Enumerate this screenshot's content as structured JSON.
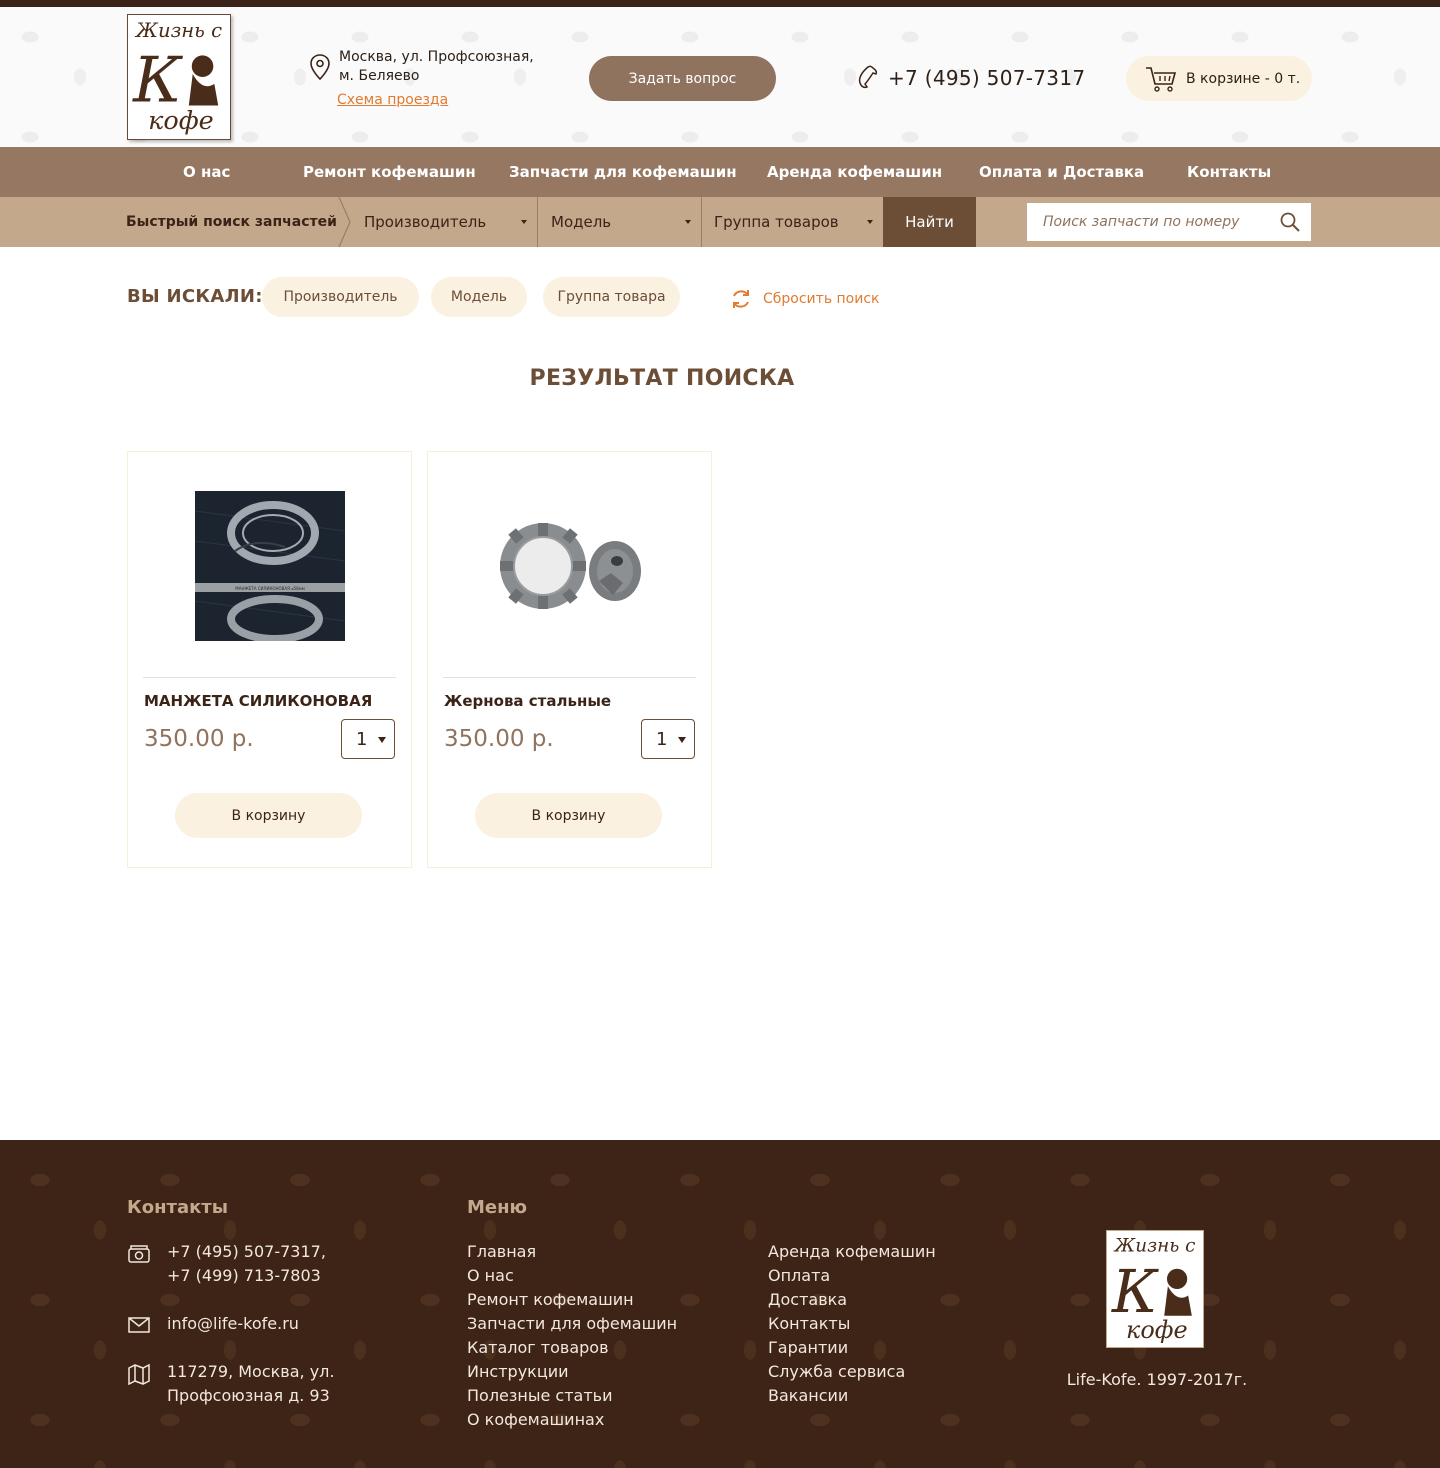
{
  "header": {
    "logo_text_top": "Жизнь с",
    "logo_text_bottom": "кофе",
    "address_line1": "Москва, ул. Профсоюзная,",
    "address_line2": "м. Беляево",
    "route_link": "Схема проезда",
    "ask_button": "Задать вопрос",
    "phone": "+7 (495) 507-7317",
    "cart_label": "В корзине - 0 т."
  },
  "nav": {
    "items": [
      {
        "label": "О нас"
      },
      {
        "label": "Ремонт кофемашин"
      },
      {
        "label": "Запчасти для кофемашин"
      },
      {
        "label": "Аренда кофемашин"
      },
      {
        "label": "Оплата и Доставка"
      },
      {
        "label": "Контакты"
      }
    ]
  },
  "search_bar": {
    "label": "Быстрый поиск запчастей",
    "manufacturer": "Производитель",
    "model": "Модель",
    "group": "Группа товаров",
    "find_button": "Найти",
    "number_placeholder": "Поиск запчасти по номеру"
  },
  "filters": {
    "title": "ВЫ ИСКАЛИ:",
    "chips": [
      "Производитель",
      "Модель",
      "Группа товара"
    ],
    "reset": "Сбросить поиск"
  },
  "results": {
    "title": "РЕЗУЛЬТАТ ПОИСКА",
    "products": [
      {
        "name": "МАНЖЕТА СИЛИКОНОВАЯ",
        "price": "350.00 р.",
        "qty": "1",
        "button": "В корзину",
        "image_caption": "МАНЖЕТА СИЛИКОНОВАЯ ⌀58мм"
      },
      {
        "name": "Жернова стальные",
        "price": "350.00 р.",
        "qty": "1",
        "button": "В корзину"
      }
    ]
  },
  "footer": {
    "contacts_title": "Контакты",
    "phone1": "+7 (495) 507-7317,",
    "phone2": "+7 (499) 713-7803",
    "email": "info@life-kofe.ru",
    "address1": "117279, Москва, ул.",
    "address2": "Профсоюзная д. 93",
    "menu_title": "Меню",
    "menu_col1": [
      "Главная",
      "О нас",
      "Ремонт кофемашин",
      "Запчасти для офемашин",
      "Каталог товаров",
      "Инструкции",
      "Полезные статьи",
      "О кофемашинах"
    ],
    "menu_col2": [
      "Аренда кофемашин",
      "Оплата",
      "Доставка",
      "Контакты",
      "Гарантии",
      "Служба сервиса",
      "Вакансии"
    ],
    "copyright": "Life-Kofe. 1997-2017г."
  },
  "colors": {
    "brand_brown": "#957762",
    "dark_brown": "#3b2417",
    "tan": "#c4a88b",
    "cream": "#fbf1e1",
    "accent_orange": "#e07b2f"
  },
  "icons": [
    "map-pin-icon",
    "phone-icon",
    "cart-icon",
    "search-icon",
    "refresh-icon",
    "footer-phone-icon",
    "mail-icon",
    "map-icon"
  ]
}
